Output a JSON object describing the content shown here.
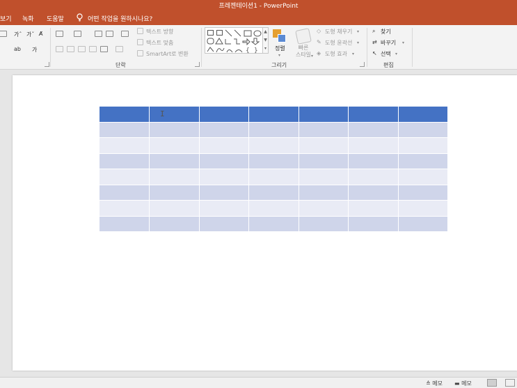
{
  "window": {
    "title": "프레젠테이션1 - PowerPoint",
    "titlebar_color": "#c0502c"
  },
  "menu": {
    "items": [
      {
        "label": "보기"
      },
      {
        "label": "녹화"
      },
      {
        "label": "도움말"
      }
    ],
    "tell_me": "어떤 작업을 원하시나요?",
    "tell_me_icon": "lightbulb-icon"
  },
  "ribbon": {
    "paragraph": {
      "label": "단락",
      "text_direction": "텍스트 방향",
      "align_text": "텍스트 맞춤",
      "smartart": "SmartArt로 변환"
    },
    "drawing": {
      "label": "그리기",
      "arrange": "정렬",
      "quick_styles": "빠른\n스타일",
      "shape_fill": "도형 채우기",
      "shape_outline": "도형 윤곽선",
      "shape_effects": "도형 효과"
    },
    "editing": {
      "label": "편집",
      "find": "찾기",
      "replace": "바꾸기",
      "select": "선택"
    }
  },
  "slide": {
    "table": {
      "columns": 7,
      "rows": 8,
      "header_color": "#4472c4",
      "band_dark": "#cfd5ea",
      "band_light": "#e9ebf5"
    }
  },
  "status": {
    "notes": "메모",
    "comments": "메모"
  }
}
